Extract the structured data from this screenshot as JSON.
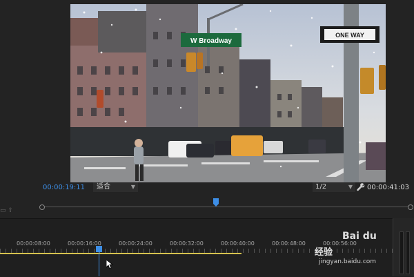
{
  "monitor": {
    "current_time": "00:00:19:11",
    "fit_option": "适合",
    "resolution": "1/2",
    "duration": "00:00:41:03",
    "street_sign_primary": "W Broadway",
    "street_sign_secondary": "ONE WAY"
  },
  "timeline": {
    "ruler_labels": [
      "00:00:08:00",
      "00:00:16:00",
      "00:00:24:00",
      "00:00:32:00",
      "00:00:40:00",
      "00:00:48:00",
      "00:00:56:00"
    ]
  },
  "watermark": {
    "logo": "Bai du",
    "text": "经验",
    "url": "jingyan.baidu.com"
  },
  "icons": {
    "wrench": "wrench-icon",
    "fit_chevron": "chevron-down-icon",
    "resolution_chevron": "chevron-down-icon",
    "playhead": "playhead-icon",
    "cursor": "mouse-pointer-icon"
  },
  "colors": {
    "accent": "#3d8ee6",
    "work_area": "#d5c24e",
    "panel_bg": "#232323"
  }
}
